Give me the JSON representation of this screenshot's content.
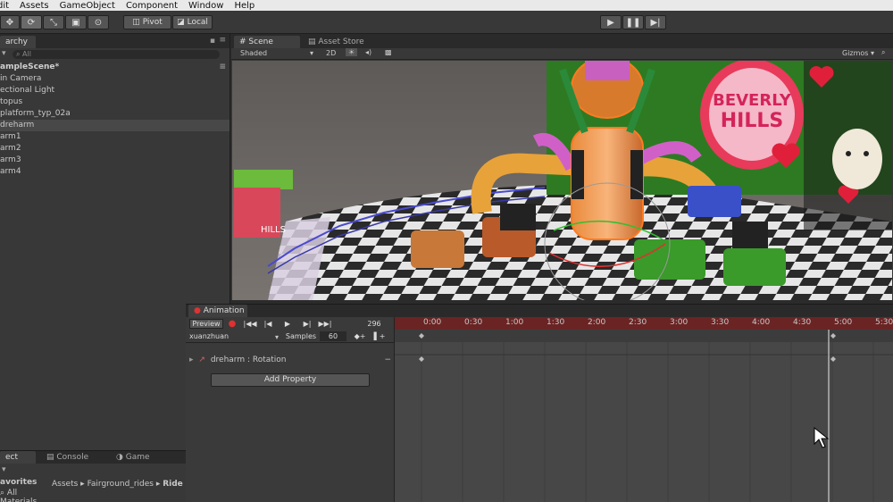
{
  "menu": [
    "dit",
    "Assets",
    "GameObject",
    "Component",
    "Window",
    "Help"
  ],
  "toolbar": {
    "pivot": "Pivot",
    "local": "Local"
  },
  "hierarchy": {
    "tab": "archy",
    "search_placeholder": "All",
    "scene": "ampleScene*",
    "items": [
      "in Camera",
      "ectional Light",
      "topus",
      "platform_typ_02a",
      "dreharm",
      "arm1",
      "arm2",
      "arm3",
      "arm4"
    ]
  },
  "scene_view": {
    "tab_scene": "Scene",
    "tab_asset_store": "Asset Store",
    "shading": "Shaded",
    "mode_2d": "2D",
    "gizmos": "Gizmos",
    "sign_text_1": "BEVERLY",
    "sign_text_2": "HILLS",
    "left_sign": "HILLS"
  },
  "animation": {
    "tab": "Animation",
    "preview": "Preview",
    "frame": "296",
    "clip": "xuanzhuan",
    "samples_label": "Samples",
    "samples": "60",
    "property": "dreharm : Rotation",
    "add_property": "Add Property",
    "ticks": [
      "0:00",
      "0:30",
      "1:00",
      "1:30",
      "2:00",
      "2:30",
      "3:00",
      "3:30",
      "4:00",
      "4:30",
      "5:00",
      "5:30"
    ]
  },
  "project": {
    "tab_project": "ect",
    "tab_console": "Console",
    "tab_game": "Game",
    "favorites": "avorites",
    "all_materials": "All Materials",
    "breadcrumb": [
      "Assets",
      "Fairground_rides",
      "Ride"
    ]
  }
}
